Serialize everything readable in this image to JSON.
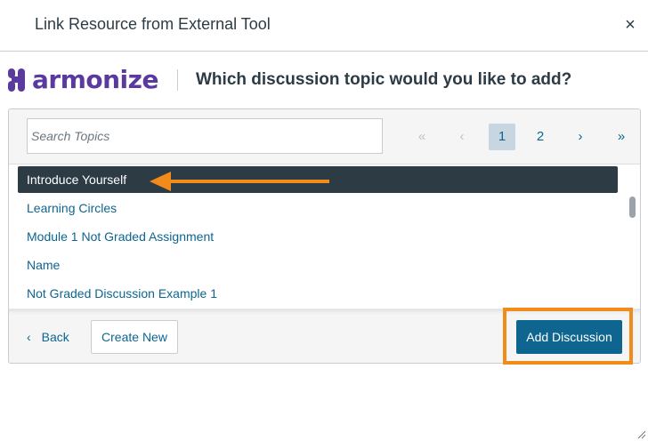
{
  "dialog": {
    "title": "Link Resource from External Tool",
    "close_glyph": "×"
  },
  "brand": {
    "logo_text": "armonize",
    "heading": "Which discussion topic would you like to add?"
  },
  "search": {
    "placeholder": "Search Topics",
    "value": ""
  },
  "pagination": {
    "first_glyph": "«",
    "prev_glyph": "‹",
    "pages": [
      "1",
      "2"
    ],
    "current_page": "1",
    "next_glyph": "›",
    "last_glyph": "»"
  },
  "topics": [
    "Introduce Yourself",
    "Learning Circles",
    "Module 1 Not Graded Assignment",
    "Name",
    "Not Graded Discussion Example 1"
  ],
  "selected_topic": "Introduce Yourself",
  "footer": {
    "back_label": "Back",
    "back_glyph": "‹",
    "create_label": "Create New",
    "add_label": "Add Discussion"
  },
  "colors": {
    "brand_purple": "#5b3aa0",
    "link_blue": "#0e6590",
    "selected_bg": "#2d3b45",
    "annotation_orange": "#f38b1b"
  },
  "icons": {
    "close": "close-icon",
    "first": "double-chevron-left-icon",
    "prev": "chevron-left-icon",
    "next": "chevron-right-icon",
    "last": "double-chevron-right-icon",
    "back": "chevron-left-icon",
    "annotation": "arrow-left-icon"
  }
}
